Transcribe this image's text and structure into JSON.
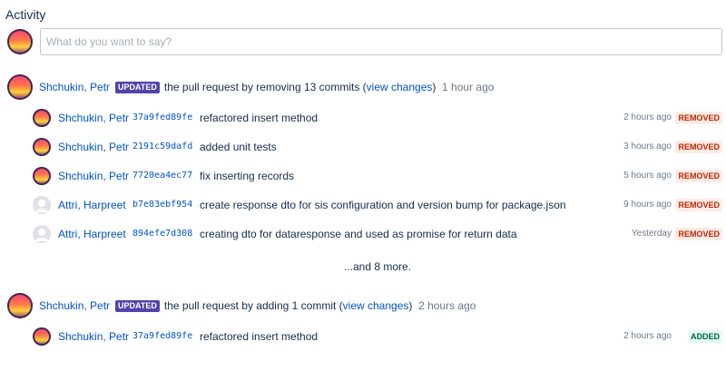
{
  "heading": "Activity",
  "comment": {
    "placeholder": "What do you want to say?"
  },
  "activities": [
    {
      "user": "Shchukin, Petr",
      "badge": "UPDATED",
      "text_before": "the pull request by removing 13 commits (",
      "link": "view changes",
      "text_after": ")",
      "time": "1 hour ago",
      "commits": [
        {
          "user": "Shchukin, Petr",
          "hash": "37a9fed89fe",
          "message": "refactored insert method",
          "time": "2 hours ago",
          "status": "REMOVED"
        },
        {
          "user": "Shchukin, Petr",
          "hash": "2191c59dafd",
          "message": "added unit tests",
          "time": "3 hours ago",
          "status": "REMOVED"
        },
        {
          "user": "Shchukin, Petr",
          "hash": "7720ea4ec77",
          "message": "fix inserting records",
          "time": "5 hours ago",
          "status": "REMOVED"
        },
        {
          "user": "Attri, Harpreet",
          "hash": "b7e83ebf954",
          "message": "create response dto for sis configuration and version bump for package.json",
          "time": "9 hours ago",
          "status": "REMOVED"
        },
        {
          "user": "Attri, Harpreet",
          "hash": "894efe7d308",
          "message": "creating dto for dataresponse and used as promise for return data",
          "time": "Yesterday",
          "status": "REMOVED"
        }
      ],
      "more": "...and 8 more."
    },
    {
      "user": "Shchukin, Petr",
      "badge": "UPDATED",
      "text_before": "the pull request by adding 1 commit (",
      "link": "view changes",
      "text_after": ")",
      "time": "2 hours ago",
      "commits": [
        {
          "user": "Shchukin, Petr",
          "hash": "37a9fed89fe",
          "message": "refactored insert method",
          "time": "2 hours ago",
          "status": "ADDED"
        }
      ]
    }
  ],
  "colors": {
    "link": "#0052cc",
    "updated_badge": "#5243aa",
    "removed": "#bf2600",
    "added": "#006644"
  }
}
